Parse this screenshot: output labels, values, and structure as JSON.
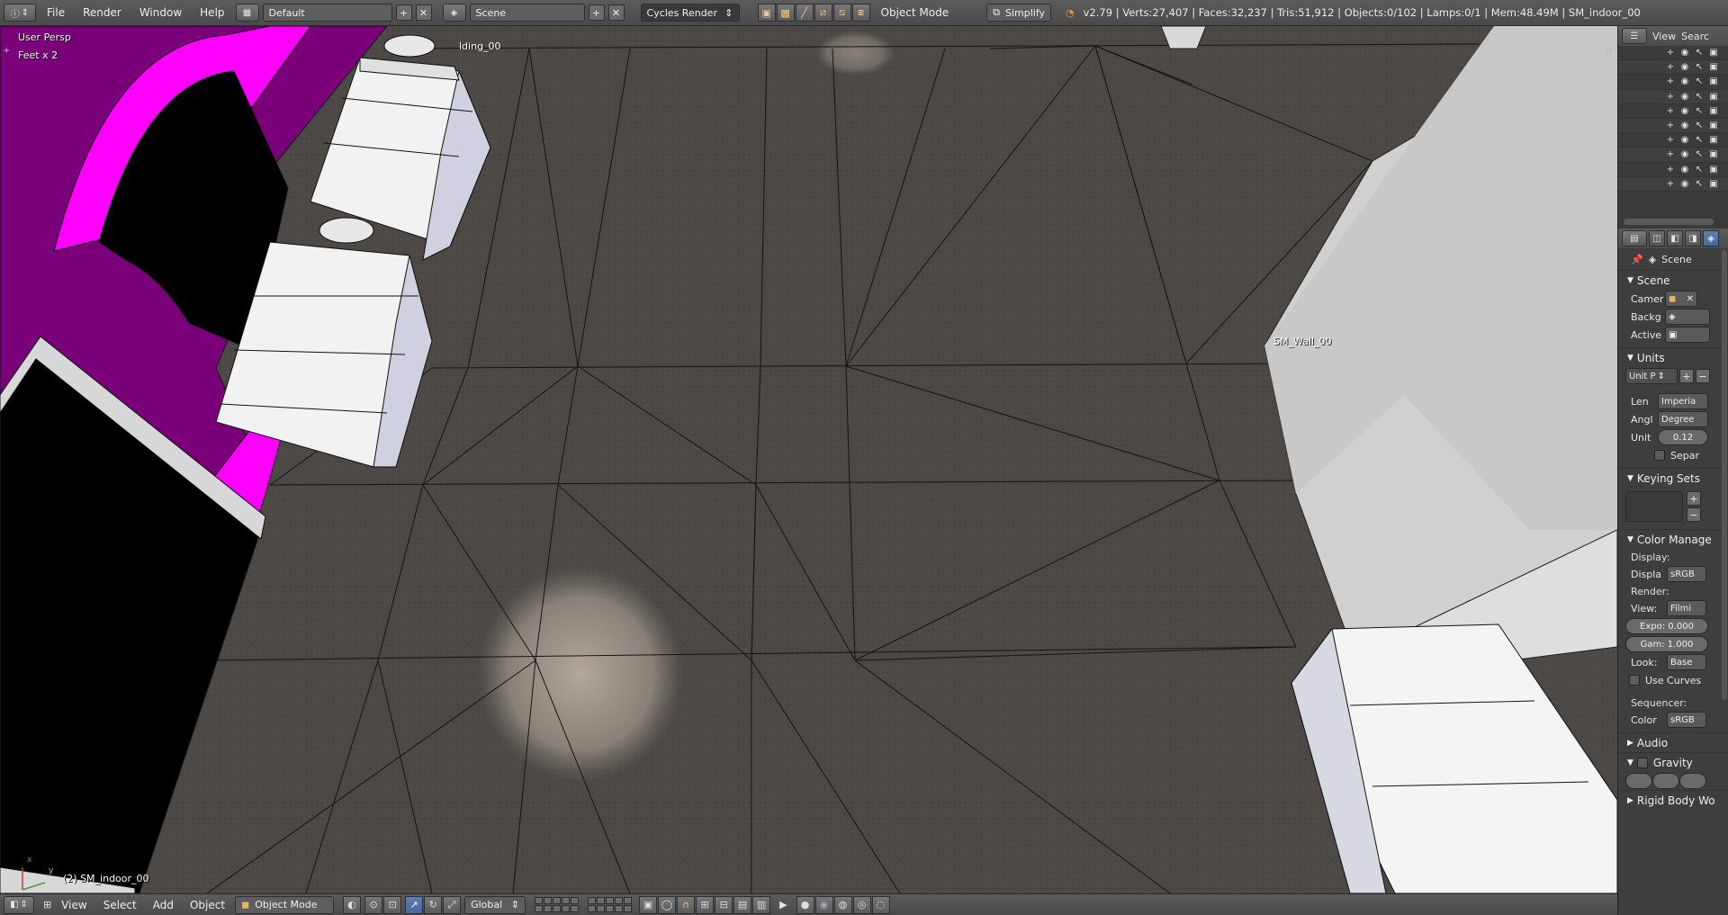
{
  "topbar": {
    "editor_icon": "info-icon",
    "menus": [
      "File",
      "Render",
      "Window",
      "Help"
    ],
    "screen_layout": "Default",
    "scene": "Scene",
    "render_engine": "Cycles Render",
    "mode_label": "Object Mode",
    "simplify_label": "Simplify",
    "stats": "v2.79 | Verts:27,407 | Faces:32,237 | Tris:51,912 | Objects:0/102 | Lamps:0/1 | Mem:48.49M | SM_indoor_00"
  },
  "viewport": {
    "view_name": "User Persp",
    "units_scale": "Feet x 2",
    "active_object": "(2) SM_indoor_00",
    "labels": {
      "building": "lding_00",
      "wall": "SM_Wall_00"
    },
    "axis": {
      "x": "x",
      "y": "y"
    },
    "colors": {
      "floor": "#4b4845",
      "magenta": "#ff00ff",
      "dark_magenta": "#7a007a",
      "furniture": "#f2f2f2",
      "wall": "#cfcfcf"
    }
  },
  "outliner": {
    "menu_view": "View",
    "menu_search": "Searc"
  },
  "properties": {
    "context": "Scene",
    "scene_panel": {
      "title": "Scene",
      "camera_label": "Camer",
      "background_label": "Backg",
      "active_label": "Active"
    },
    "units_panel": {
      "title": "Units",
      "preset": "Unit P",
      "length_label": "Len",
      "length_value": "Imperia",
      "angle_label": "Angl",
      "angle_value": "Degree",
      "unit_label": "Unit",
      "unit_value": "0.12",
      "separate_label": "Separ"
    },
    "keying_panel": {
      "title": "Keying Sets"
    },
    "color_panel": {
      "title": "Color Manage",
      "display_heading": "Display:",
      "display_label": "Displa",
      "display_value": "sRGB",
      "render_heading": "Render:",
      "view_label": "View:",
      "view_value": "Filmi",
      "exposure": "Expo: 0.000",
      "gamma": "Gam: 1.000",
      "look_label": "Look:",
      "look_value": "Base",
      "use_curves": "Use Curves",
      "sequencer_heading": "Sequencer:",
      "color_label": "Color",
      "color_value": "sRGB"
    },
    "audio_panel": {
      "title": "Audio"
    },
    "gravity_panel": {
      "title": "Gravity"
    },
    "rigid_panel": {
      "title": "Rigid Body Wo"
    }
  },
  "bottombar": {
    "menus": [
      "View",
      "Select",
      "Add",
      "Object"
    ],
    "mode": "Object Mode",
    "orientation": "Global"
  }
}
